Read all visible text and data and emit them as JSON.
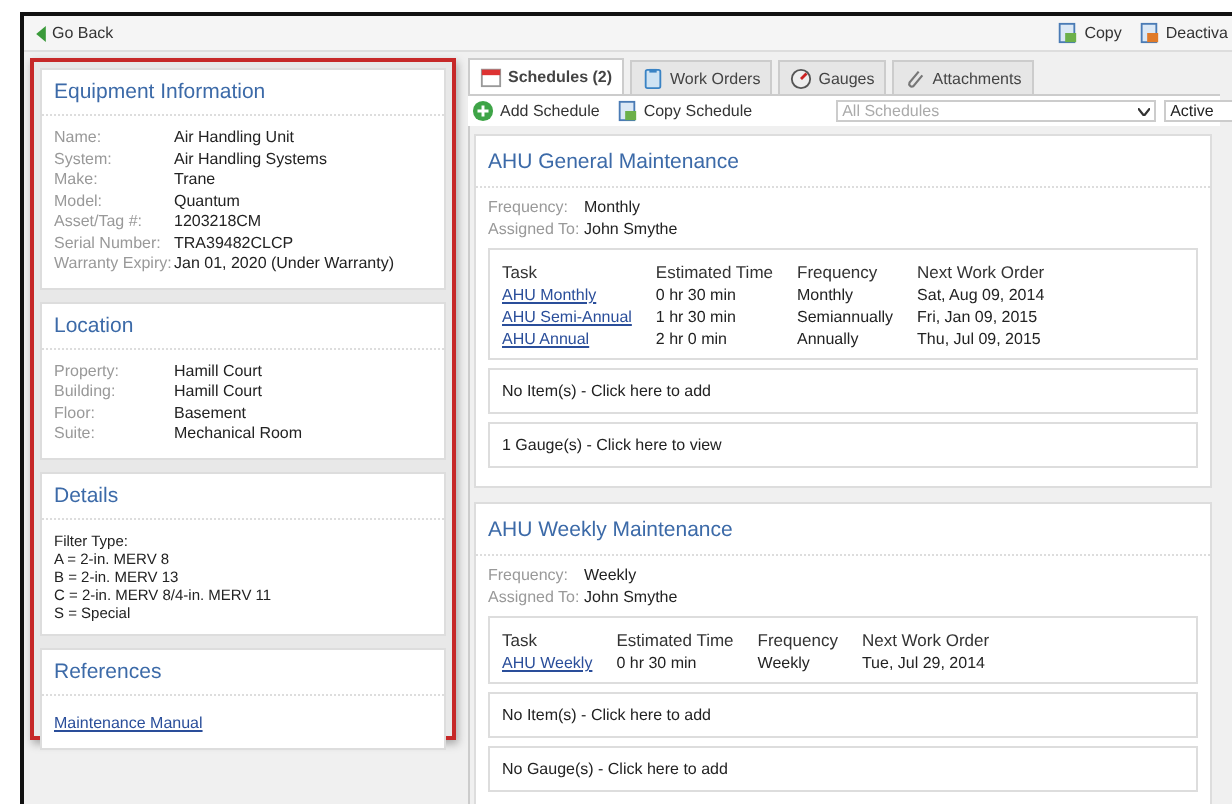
{
  "top_bar": {
    "back_label": "Go Back",
    "actions": [
      {
        "label": "Copy",
        "kind": "copy"
      },
      {
        "label": "Deactiva",
        "kind": "deactivate"
      }
    ]
  },
  "sections": [
    {
      "title": "Equipment Information",
      "kind": "fields",
      "fields": [
        {
          "label": "Name:",
          "value": "Air Handling Unit"
        },
        {
          "label": "System:",
          "value": "Air Handling Systems"
        },
        {
          "label": "Make:",
          "value": "Trane"
        },
        {
          "label": "Model:",
          "value": "Quantum"
        },
        {
          "label": "Asset/Tag #:",
          "value": "1203218CM"
        },
        {
          "label": "Serial Number:",
          "value": "TRA39482CLCP"
        },
        {
          "label": "Warranty Expiry:",
          "value": "Jan 01, 2020 (Under Warranty)"
        }
      ]
    },
    {
      "title": "Location",
      "kind": "fields",
      "fields": [
        {
          "label": "Property:",
          "value": "Hamill Court"
        },
        {
          "label": "Building:",
          "value": "Hamill Court"
        },
        {
          "label": "Floor:",
          "value": "Basement"
        },
        {
          "label": "Suite:",
          "value": "Mechanical Room"
        }
      ]
    },
    {
      "title": "Details",
      "kind": "text",
      "lines": [
        "Filter Type:",
        "A = 2-in. MERV 8",
        "B = 2-in. MERV 13",
        "C = 2-in. MERV 8/4-in. MERV 11",
        "S = Special"
      ]
    },
    {
      "title": "References",
      "kind": "links",
      "links": [
        "Maintenance Manual"
      ]
    }
  ],
  "tabs": [
    {
      "label": "Schedules (2)",
      "kind": "calendar",
      "selected": true
    },
    {
      "label": "Work Orders",
      "kind": "workorders",
      "selected": false
    },
    {
      "label": "Gauges",
      "kind": "gauge",
      "selected": false
    },
    {
      "label": "Attachments",
      "kind": "clip",
      "selected": false
    }
  ],
  "toolbar": {
    "buttons": [
      {
        "label": "Add Schedule",
        "kind": "add"
      },
      {
        "label": "Copy Schedule",
        "kind": "copy"
      }
    ],
    "schedule_filter": "All Schedules",
    "status_filter": "Active"
  },
  "schedules": [
    {
      "title": "AHU General Maintenance",
      "frequency_label": "Frequency:",
      "frequency": "Monthly",
      "assigned_label": "Assigned To:",
      "assigned": "John Smythe",
      "columns": [
        "Task",
        "Estimated Time",
        "Frequency",
        "Next Work Order"
      ],
      "rows": [
        [
          "AHU Monthly",
          "0 hr 30 min",
          "Monthly",
          "Sat, Aug 09, 2014"
        ],
        [
          "AHU Semi-Annual",
          "1 hr 30 min",
          "Semiannually",
          "Fri, Jan 09, 2015"
        ],
        [
          "AHU Annual",
          "2 hr 0 min",
          "Annually",
          "Thu, Jul 09, 2015"
        ]
      ],
      "items_text": "No Item(s) - Click here to add",
      "gauges_text": "1 Gauge(s) - Click here to view"
    },
    {
      "title": "AHU Weekly Maintenance",
      "frequency_label": "Frequency:",
      "frequency": "Weekly",
      "assigned_label": "Assigned To:",
      "assigned": "John Smythe",
      "columns": [
        "Task",
        "Estimated Time",
        "Frequency",
        "Next Work Order"
      ],
      "rows": [
        [
          "AHU Weekly",
          "0 hr 30 min",
          "Weekly",
          "Tue, Jul 29, 2014"
        ]
      ],
      "items_text": "No Item(s) - Click here to add",
      "gauges_text": "No Gauge(s) - Click here to add"
    }
  ]
}
